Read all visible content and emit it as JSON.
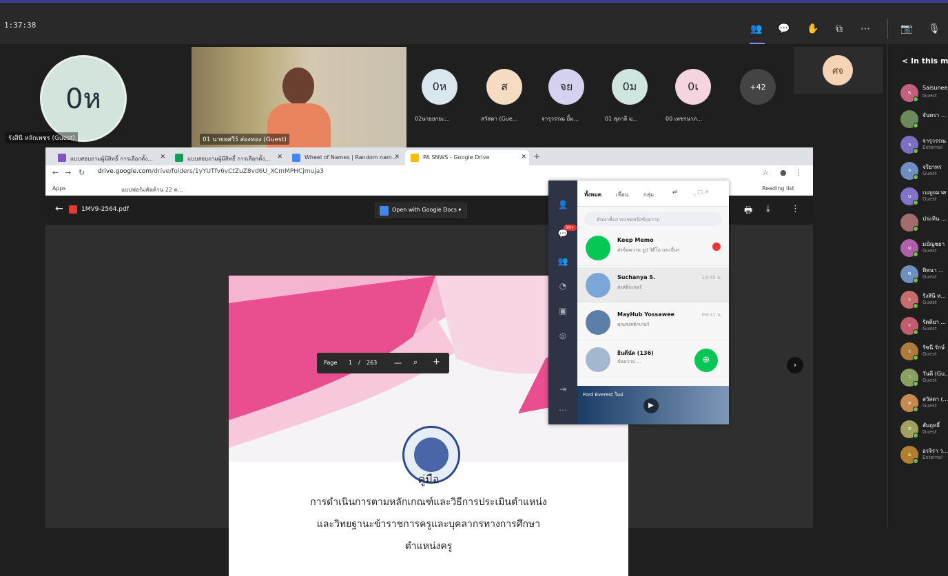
{
  "meeting": {
    "clock": "1:37:38",
    "toolbar_icons": [
      "people-icon",
      "chat-icon",
      "reactions-icon",
      "share-icon",
      "more-icon",
      "camera-off-icon",
      "mic-off-icon"
    ]
  },
  "participants": {
    "big_avatar": {
      "initials": "0ห",
      "name": "รังสินี หลักเพชร (Guest)"
    },
    "video": {
      "name": "01 นายยศวีร์ ส่องทอง (Guest)"
    },
    "circles": [
      {
        "initials": "0ห",
        "name": "02นายยกยะ...",
        "color": "#d9e8ef"
      },
      {
        "initials": "ส",
        "name": "สวัสดา (Gue...",
        "color": "#f6dcc2"
      },
      {
        "initials": "จย",
        "name": "จารุวรรณ ยิ้ม...",
        "color": "#d4d2f0"
      },
      {
        "initials": "0ม",
        "name": "01 สุภาลี ม...",
        "color": "#cfe6e0"
      },
      {
        "initials": "0เ",
        "name": "00 เพชรนาภ...",
        "color": "#f4d4de"
      }
    ],
    "more_count": "+42",
    "right_tile_initials": "ศจ"
  },
  "browser": {
    "tabs": [
      {
        "title": "แบบสอบถามผู้มีสิทธิ์ การเลือกตั้ง...",
        "color": "#7e57c2"
      },
      {
        "title": "แบบสอบถามผู้มีสิทธิ์ การเลือกตั้ง...",
        "color": "#0f9d58"
      },
      {
        "title": "Wheel of Names | Random nam...",
        "color": "#4285f4"
      },
      {
        "title": "PA SNWS - Google Drive",
        "color": "#fbbc04"
      }
    ],
    "url_host": "drive.google.com",
    "url_path": "/drive/folders/1yYUTfv6vCtZuZ8vd6U_XCmMPHCjmuja3",
    "bookmarks": [
      "Apps",
      "แบบฟอร์มคัดค้าน 22 ค..."
    ],
    "reading_list": "Reading list"
  },
  "pdf": {
    "filename": "1MV9-2564.pdf",
    "open_with": "Open with Google Docs",
    "title_lines": [
      "คู่มือ",
      "การดำเนินการตามหลักเกณฑ์และวิธีการประเมินตำแหน่ง",
      "และวิทยฐานะข้าราชการครูและบุคลากรทางการศึกษา",
      "ตำแหน่งครู"
    ],
    "page_label": "Page",
    "page_current": "1",
    "page_sep": "/",
    "page_total": "263"
  },
  "chat_app": {
    "tabs": [
      "ทั้งหมด",
      "เพื่อน",
      "กลุ่ม"
    ],
    "search_placeholder": "ค้นหาชื่อการแชทหรือข้อความ",
    "badge": "99+",
    "rows": [
      {
        "name": "Keep Memo",
        "preview": "ส่งข้อความ รูป วิดีโอ และอื่นๆ",
        "time": "",
        "avatar_color": "#06c755"
      },
      {
        "name": "Suchanya S.",
        "preview": "ส่งสติกเกอร์",
        "time": "14:45 น.",
        "avatar_color": "#7ba7d8"
      },
      {
        "name": "MayHub Yossawee",
        "preview": "คุณส่งสติกเกอร์",
        "time": "09:21 น.",
        "avatar_color": "#5b7fa6"
      },
      {
        "name": "ยินดีนัด (136)",
        "preview": "ข้อความ ...",
        "time": "",
        "avatar_color": "#a3b9cf"
      }
    ],
    "ad_text": "Ford Everest ใหม่"
  },
  "people_panel": {
    "title": "In this meeting",
    "people": [
      {
        "name": "Saisunee",
        "status": "Guest",
        "initials": "S",
        "color": "#c2607d"
      },
      {
        "name": "จันทรา ...",
        "status": "",
        "initials": "",
        "color": "#6c8a5a"
      },
      {
        "name": "จารุวรรณ",
        "status": "External",
        "initials": "จ",
        "color": "#7a6fc0"
      },
      {
        "name": "จริยาพร",
        "status": "Guest",
        "initials": "จ",
        "color": "#6f8fc0"
      },
      {
        "name": "เบญจมาศ",
        "status": "Guest",
        "initials": "บ",
        "color": "#7f74c8"
      },
      {
        "name": "ประทิน ...",
        "status": "",
        "initials": "",
        "color": "#a36d6d"
      },
      {
        "name": "มนัญชยา",
        "status": "Guest",
        "initials": "ม",
        "color": "#b060a8"
      },
      {
        "name": "ทิพนา ...",
        "status": "Guest",
        "initials": "ท",
        "color": "#6f8fc0"
      },
      {
        "name": "รังสินี ห...",
        "status": "Guest",
        "initials": "ร",
        "color": "#c56d6d"
      },
      {
        "name": "รัตติยา ...",
        "status": "Guest",
        "initials": "ร",
        "color": "#c05d6f"
      },
      {
        "name": "รัชนี รักษ์",
        "status": "Guest",
        "initials": "ร",
        "color": "#b07a3a"
      },
      {
        "name": "วันดี (Gu...",
        "status": "Guest",
        "initials": "ว",
        "color": "#8aa060"
      },
      {
        "name": "สวัสดา (...",
        "status": "Guest",
        "initials": "ส",
        "color": "#c68a50"
      },
      {
        "name": "สัมฤทธิ์",
        "status": "Guest",
        "initials": "ส",
        "color": "#a0a060"
      },
      {
        "name": "อรจิรา ว...",
        "status": "External",
        "initials": "อ",
        "color": "#b08030"
      }
    ]
  }
}
